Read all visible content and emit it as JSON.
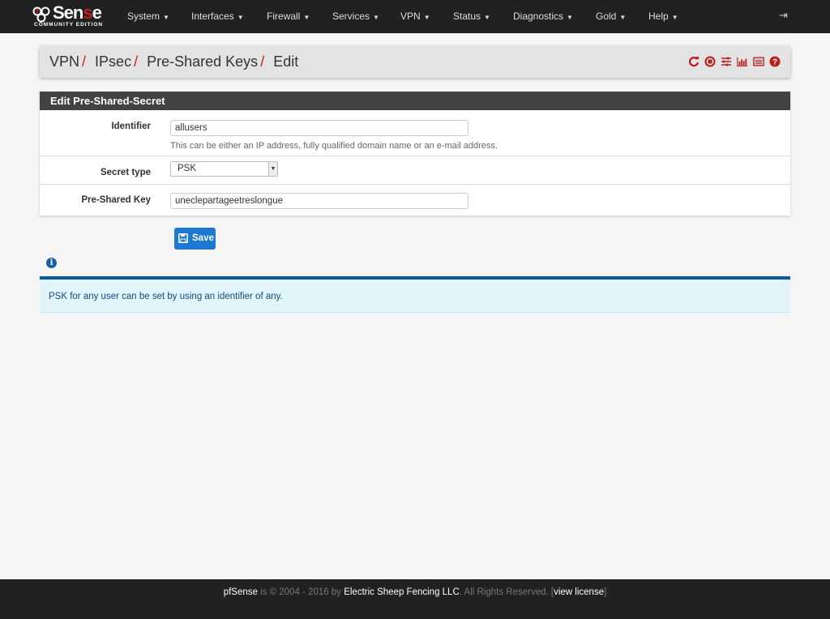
{
  "brand": {
    "name": "pfSense",
    "edition": "COMMUNITY EDITION"
  },
  "nav": {
    "items": [
      "System",
      "Interfaces",
      "Firewall",
      "Services",
      "VPN",
      "Status",
      "Diagnostics",
      "Gold",
      "Help"
    ],
    "logout_icon": "sign-out-icon"
  },
  "breadcrumb": [
    "VPN",
    "IPsec",
    "Pre-Shared Keys",
    "Edit"
  ],
  "breadcrumb_icons": [
    "restart-icon",
    "stop-icon",
    "settings-sliders-icon",
    "bar-chart-icon",
    "log-list-icon",
    "help-icon"
  ],
  "panel": {
    "title": "Edit Pre-Shared-Secret",
    "identifier": {
      "label": "Identifier",
      "value": "allusers",
      "help": "This can be either an IP address, fully qualified domain name or an e-mail address."
    },
    "secret_type": {
      "label": "Secret type",
      "value": "PSK"
    },
    "psk": {
      "label": "Pre-Shared Key",
      "value": "uneclepartageetreslongue"
    }
  },
  "save_label": "Save",
  "info": {
    "text": "PSK for any user can be set by using an identifier of any."
  },
  "footer": {
    "brand": "pfSense",
    "copy": " is © 2004 - 2016 by ",
    "company": "Electric Sheep Fencing LLC",
    "rights": ". All Rights Reserved. [",
    "license": "view license",
    "end": "]"
  },
  "colors": {
    "navbar": "#212121",
    "accent_red": "#c41e1e",
    "button_blue": "#1e78d2",
    "panel_header": "#424242",
    "info_bg": "#e1f5fb"
  }
}
